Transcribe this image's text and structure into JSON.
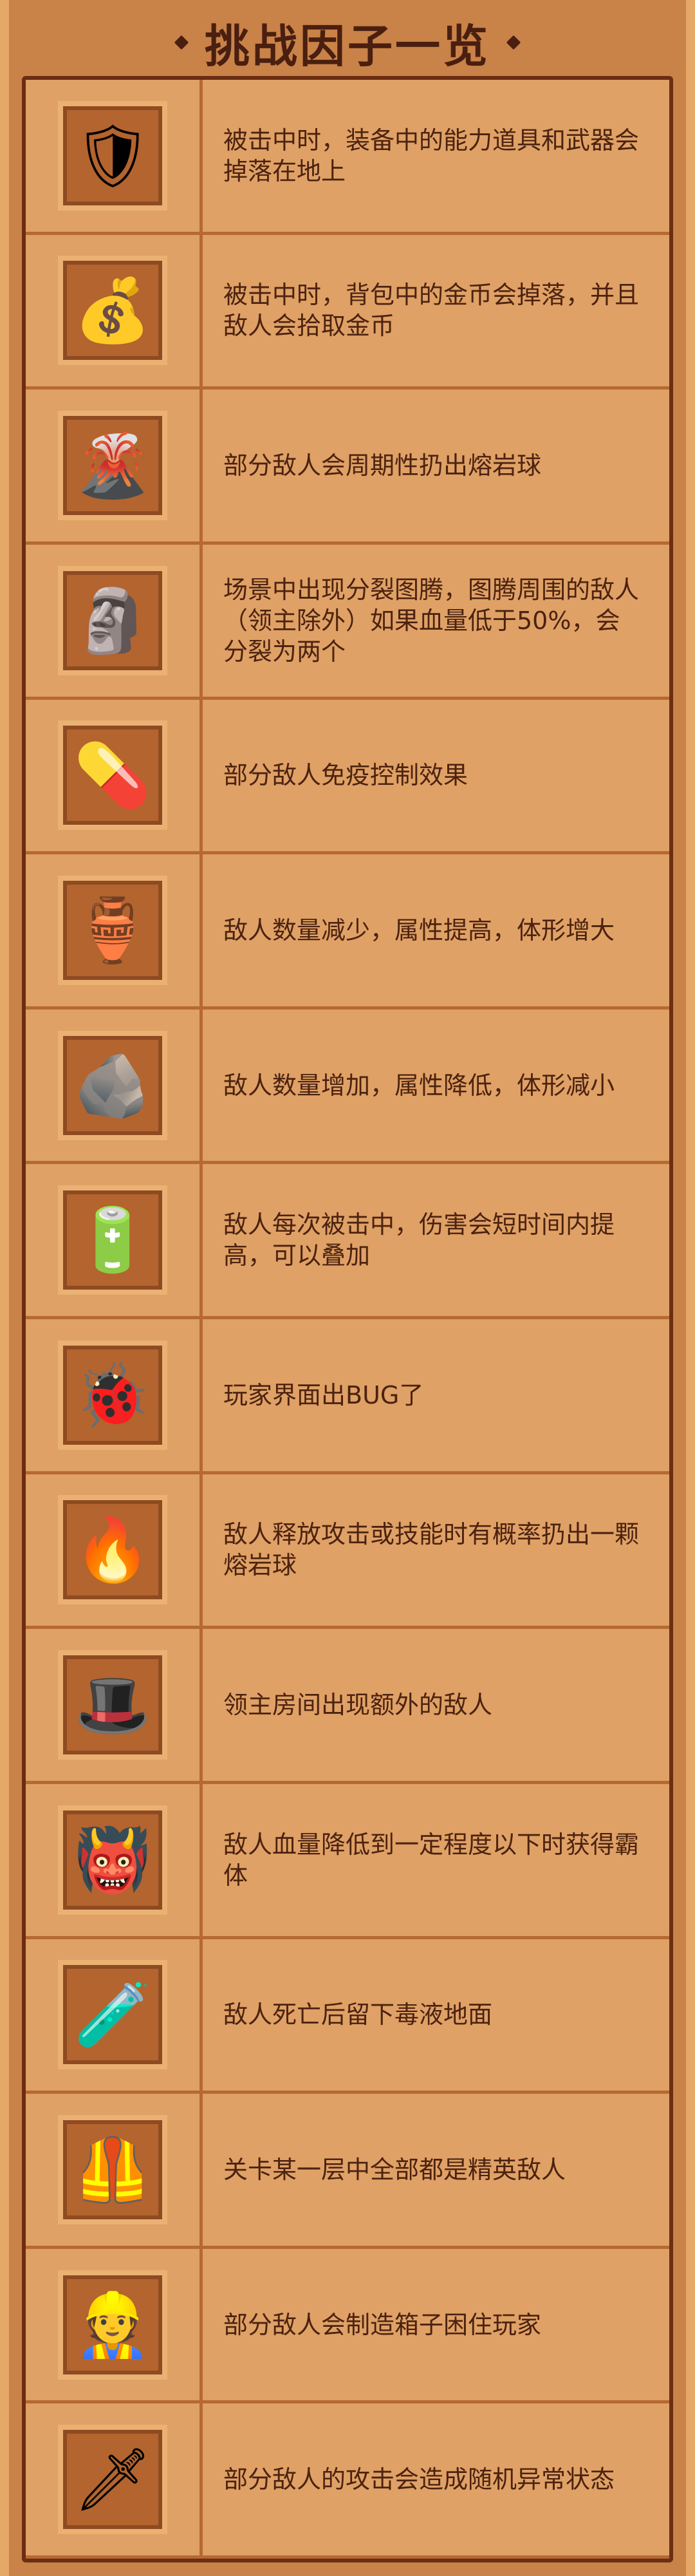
{
  "title": "挑战因子一览",
  "factors": [
    {
      "icon": "jelly-shield-icon",
      "glyph": "🛡",
      "text": "被击中时，装备中的能力道具和武器会掉落在地上"
    },
    {
      "icon": "gold-coin-bag-icon",
      "glyph": "💰",
      "text": "被击中时，背包中的金币会掉落，并且敌人会拾取金币"
    },
    {
      "icon": "volcano-icon",
      "glyph": "🌋",
      "text": "部分敌人会周期性扔出熔岩球"
    },
    {
      "icon": "totem-icon",
      "glyph": "🗿",
      "text": "场景中出现分裂图腾，图腾周围的敌人（领主除外）如果血量低于50%，会分裂为两个"
    },
    {
      "icon": "pill-icon",
      "glyph": "💊",
      "text": "部分敌人免疫控制效果"
    },
    {
      "icon": "cannon-icon",
      "glyph": "🏺",
      "text": "敌人数量减少，属性提高，体形增大"
    },
    {
      "icon": "rubble-icon",
      "glyph": "🪨",
      "text": "敌人数量增加，属性降低，体形减小"
    },
    {
      "icon": "battery-icon",
      "glyph": "🔋",
      "text": "敌人每次被击中，伤害会短时间内提高，可以叠加"
    },
    {
      "icon": "ui-bug-icon",
      "glyph": "🐞",
      "text": "玩家界面出BUG了"
    },
    {
      "icon": "fire-flask-icon",
      "glyph": "🔥",
      "text": "敌人释放攻击或技能时有概率扔出一颗熔岩球"
    },
    {
      "icon": "hat-ghost-icon",
      "glyph": "🎩",
      "text": "领主房间出现额外的敌人"
    },
    {
      "icon": "demon-mask-icon",
      "glyph": "👹",
      "text": "敌人血量降低到一定程度以下时获得霸体"
    },
    {
      "icon": "poison-potion-icon",
      "glyph": "🧪",
      "text": "敌人死亡后留下毒液地面"
    },
    {
      "icon": "elite-armor-icon",
      "glyph": "🦺",
      "text": "关卡某一层中全部都是精英敌人"
    },
    {
      "icon": "builder-icon",
      "glyph": "👷",
      "text": "部分敌人会制造箱子困住玩家"
    },
    {
      "icon": "sword-icon",
      "glyph": "🗡",
      "text": "部分敌人的攻击会造成随机异常状态"
    }
  ]
}
